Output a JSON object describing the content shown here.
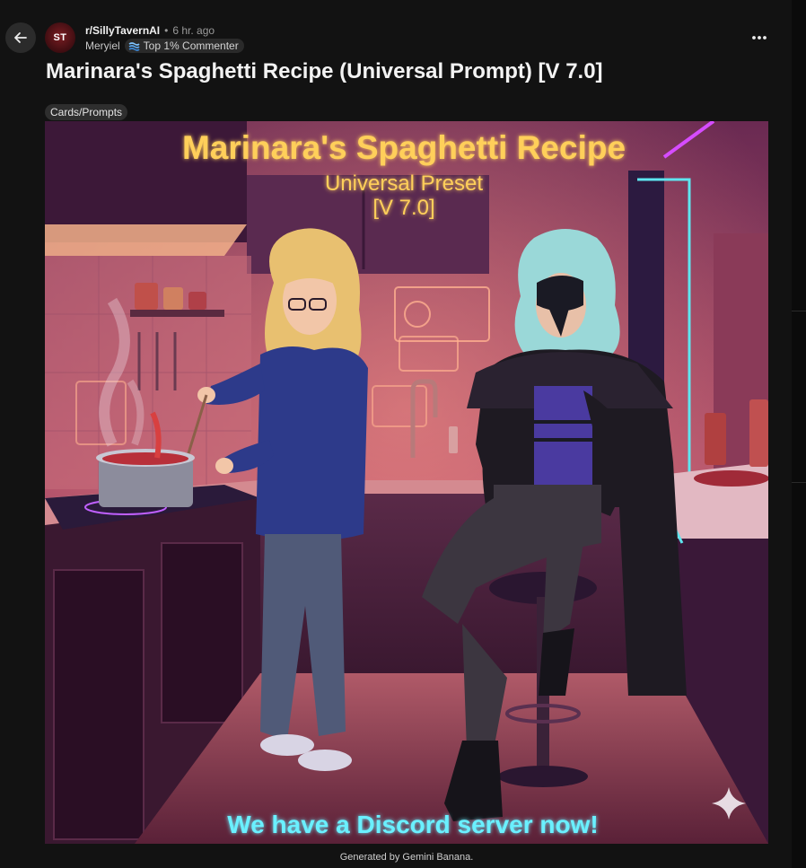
{
  "header": {
    "subreddit": "r/SillyTavernAI",
    "time": "6 hr. ago",
    "username": "Meryiel",
    "badge": "Top 1% Commenter",
    "avatar_initials": "ST"
  },
  "post": {
    "title": "Marinara's Spaghetti Recipe (Universal Prompt) [V 7.0]",
    "flair": "Cards/Prompts",
    "image": {
      "title": "Marinara's Spaghetti Recipe",
      "subtitle": "Universal Preset",
      "version": "[V 7.0]",
      "bottom_text": "We have a Discord server now!"
    },
    "caption": "Generated by Gemini Banana."
  },
  "icons": {
    "back": "arrow-left-icon",
    "more": "more-horizontal-icon",
    "badge": "commenter-badge-icon",
    "sparkle": "sparkle-icon"
  },
  "colors": {
    "background": "#121212",
    "title_glow": "#ffcf5a",
    "neon_cyan": "#5ee6f0",
    "neon_magenta": "#d64cff"
  }
}
